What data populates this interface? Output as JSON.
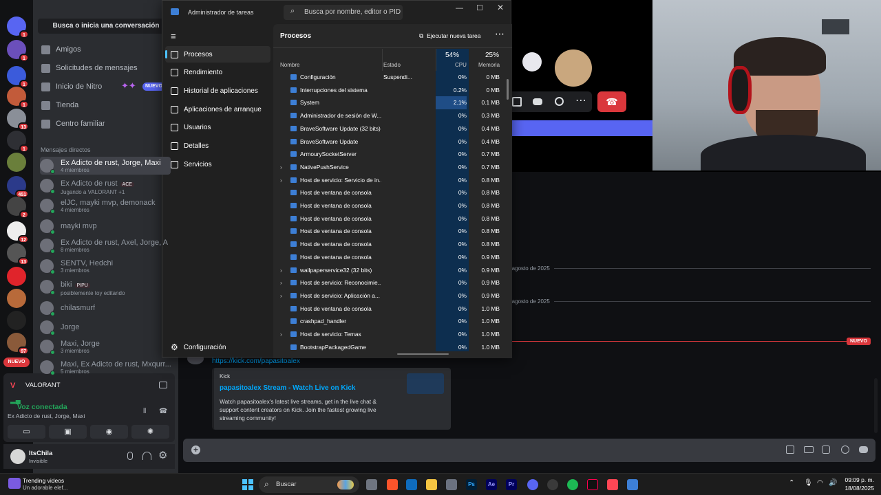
{
  "discord": {
    "search_label": "Busca o inicia una conversación",
    "nav": [
      {
        "label": "Amigos",
        "icon": "friends-icon"
      },
      {
        "label": "Solicitudes de mensajes",
        "icon": "mail-icon"
      },
      {
        "label": "Inicio de Nitro",
        "icon": "nitro-icon"
      },
      {
        "label": "Tienda",
        "icon": "shop-icon"
      },
      {
        "label": "Centro familiar",
        "icon": "family-icon"
      }
    ],
    "nitro_badge": "NUEVO",
    "dm_header": "Mensajes directos",
    "dms": [
      {
        "name": "Ex Adicto de rust, Jorge, Maxi",
        "sub": "4 miembros"
      },
      {
        "name": "Ex Adicto de rust",
        "tag": "ACE",
        "sub": "Jugando a VALORANT +1"
      },
      {
        "name": "elJC, mayki mvp, demonack",
        "sub": "4 miembros"
      },
      {
        "name": "mayki mvp",
        "sub": ""
      },
      {
        "name": "Ex Adicto de rust, Axel, Jorge, A",
        "sub": "8 miembros"
      },
      {
        "name": "SENTV, Hedchi",
        "sub": "3 miembros"
      },
      {
        "name": "biki",
        "tag": "PIPU",
        "sub": "posiblemente toy editando"
      },
      {
        "name": "chilasmurf",
        "sub": ""
      },
      {
        "name": "Jorge",
        "sub": ""
      },
      {
        "name": "Maxi, Jorge",
        "sub": "3 miembros"
      },
      {
        "name": "Maxi, Ex Adicto de rust, Mxqurr...",
        "sub": "5 miembros"
      }
    ],
    "rail_badges": [
      "1",
      "1",
      "1",
      "1",
      "13",
      "1",
      "451",
      "2",
      "12",
      "13",
      "97"
    ],
    "rail_new": "NUEVO",
    "voice": {
      "game": "VALORANT",
      "status": "Voz conectada",
      "channel": "Ex Adicto de rust, Jorge, Maxi"
    },
    "user": {
      "name": "ItsChila",
      "status": "Invisible"
    },
    "divider_dates": [
      "e agosto de 2025",
      "e agosto de 2025"
    ],
    "new_label": "NUEVO",
    "link": "https://kick.com/papasitoalex",
    "embed": {
      "provider": "Kick",
      "title": "papasitoalex Stream - Watch Live on Kick",
      "desc": "Watch papasitoalex's latest live streams, get in the live chat & support content creators on Kick. Join the fastest growing live streaming community!"
    }
  },
  "taskmgr": {
    "title": "Administrador de tareas",
    "search_placeholder": "Busca por nombre, editor o PID",
    "nav": [
      {
        "label": "Procesos",
        "icon": "processes-icon"
      },
      {
        "label": "Rendimiento",
        "icon": "performance-icon"
      },
      {
        "label": "Historial de aplicaciones",
        "icon": "history-icon"
      },
      {
        "label": "Aplicaciones de arranque",
        "icon": "startup-icon"
      },
      {
        "label": "Usuarios",
        "icon": "users-icon"
      },
      {
        "label": "Detalles",
        "icon": "details-icon"
      },
      {
        "label": "Servicios",
        "icon": "services-icon"
      }
    ],
    "settings_label": "Configuración",
    "page_title": "Procesos",
    "run_task": "Ejecutar nueva tarea",
    "columns": {
      "name": "Nombre",
      "status": "Estado",
      "cpu": "CPU",
      "mem": "Memoria"
    },
    "cpu_total": "54%",
    "mem_total": "25%",
    "processes": [
      {
        "name": "Configuración",
        "status": "Suspendi...",
        "cpu": "0%",
        "mem": "0 MB",
        "exp": false
      },
      {
        "name": "Interrupciones del sistema",
        "status": "",
        "cpu": "0.2%",
        "mem": "0 MB",
        "exp": false
      },
      {
        "name": "System",
        "status": "",
        "cpu": "2.1%",
        "mem": "0.1 MB",
        "exp": false
      },
      {
        "name": "Administrador de sesión de W...",
        "status": "",
        "cpu": "0%",
        "mem": "0.3 MB",
        "exp": false
      },
      {
        "name": "BraveSoftware Update (32 bits)",
        "status": "",
        "cpu": "0%",
        "mem": "0.4 MB",
        "exp": false
      },
      {
        "name": "BraveSoftware Update",
        "status": "",
        "cpu": "0%",
        "mem": "0.4 MB",
        "exp": false
      },
      {
        "name": "ArmourySocketServer",
        "status": "",
        "cpu": "0%",
        "mem": "0.7 MB",
        "exp": false
      },
      {
        "name": "NativePushService",
        "status": "",
        "cpu": "0%",
        "mem": "0.7 MB",
        "exp": true
      },
      {
        "name": "Host de servicio: Servicio de in...",
        "status": "",
        "cpu": "0%",
        "mem": "0.8 MB",
        "exp": true
      },
      {
        "name": "Host de ventana de consola",
        "status": "",
        "cpu": "0%",
        "mem": "0.8 MB",
        "exp": false
      },
      {
        "name": "Host de ventana de consola",
        "status": "",
        "cpu": "0%",
        "mem": "0.8 MB",
        "exp": false
      },
      {
        "name": "Host de ventana de consola",
        "status": "",
        "cpu": "0%",
        "mem": "0.8 MB",
        "exp": false
      },
      {
        "name": "Host de ventana de consola",
        "status": "",
        "cpu": "0%",
        "mem": "0.8 MB",
        "exp": false
      },
      {
        "name": "Host de ventana de consola",
        "status": "",
        "cpu": "0%",
        "mem": "0.8 MB",
        "exp": false
      },
      {
        "name": "Host de ventana de consola",
        "status": "",
        "cpu": "0%",
        "mem": "0.9 MB",
        "exp": false
      },
      {
        "name": "wallpaperservice32 (32 bits)",
        "status": "",
        "cpu": "0%",
        "mem": "0.9 MB",
        "exp": true
      },
      {
        "name": "Host de servicio: Reconocimie...",
        "status": "",
        "cpu": "0%",
        "mem": "0.9 MB",
        "exp": true
      },
      {
        "name": "Host de servicio: Aplicación a...",
        "status": "",
        "cpu": "0%",
        "mem": "0.9 MB",
        "exp": true
      },
      {
        "name": "Host de ventana de consola",
        "status": "",
        "cpu": "0%",
        "mem": "1.0 MB",
        "exp": false
      },
      {
        "name": "crashpad_handler",
        "status": "",
        "cpu": "0%",
        "mem": "1.0 MB",
        "exp": false
      },
      {
        "name": "Host de servicio: Temas",
        "status": "",
        "cpu": "0%",
        "mem": "1.0 MB",
        "exp": true
      },
      {
        "name": "BootstrapPackagedGame",
        "status": "",
        "cpu": "0%",
        "mem": "1.0 MB",
        "exp": false
      }
    ]
  },
  "taskbar": {
    "news_title": "Trending videos",
    "news_sub": "Un adorable elef...",
    "search": "Buscar",
    "time": "09:09 p. m.",
    "date": "18/08/2025"
  }
}
